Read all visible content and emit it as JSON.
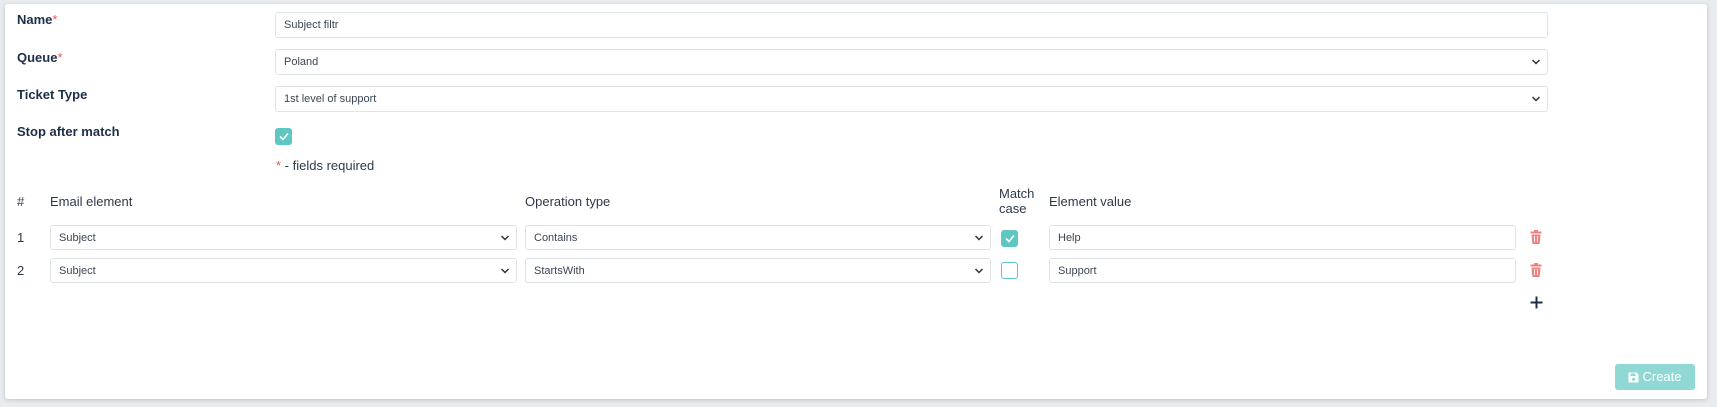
{
  "form": {
    "name": {
      "label": "Name",
      "required_mark": "*",
      "value": "Subject filtr"
    },
    "queue": {
      "label": "Queue",
      "required_mark": "*",
      "value": "Poland"
    },
    "ticket_type": {
      "label": "Ticket Type",
      "value": "1st level of support"
    },
    "stop_after_match": {
      "label": "Stop after match",
      "checked": true
    },
    "required_note": {
      "mark": "*",
      "text": " - fields required"
    }
  },
  "table": {
    "headers": {
      "num": "#",
      "email_element": "Email element",
      "operation_type": "Operation type",
      "match_case_1": "Match",
      "match_case_2": "case",
      "element_value": "Element value"
    },
    "rows": [
      {
        "num": "1",
        "email_element": "Subject",
        "operation_type": "Contains",
        "match_case": true,
        "element_value": "Help"
      },
      {
        "num": "2",
        "email_element": "Subject",
        "operation_type": "StartsWith",
        "match_case": false,
        "element_value": "Support"
      }
    ]
  },
  "actions": {
    "create_label": "Create"
  },
  "colors": {
    "accent": "#5ec7c1",
    "accent_light": "#8fd8d3",
    "required": "#e05b5b",
    "delete": "#f08080",
    "heading": "#1d2f45"
  },
  "icons": {
    "delete": "trash-icon",
    "add": "plus-icon",
    "save": "floppy-disk-icon",
    "dropdown": "chevron-down-icon",
    "check": "check-icon"
  }
}
